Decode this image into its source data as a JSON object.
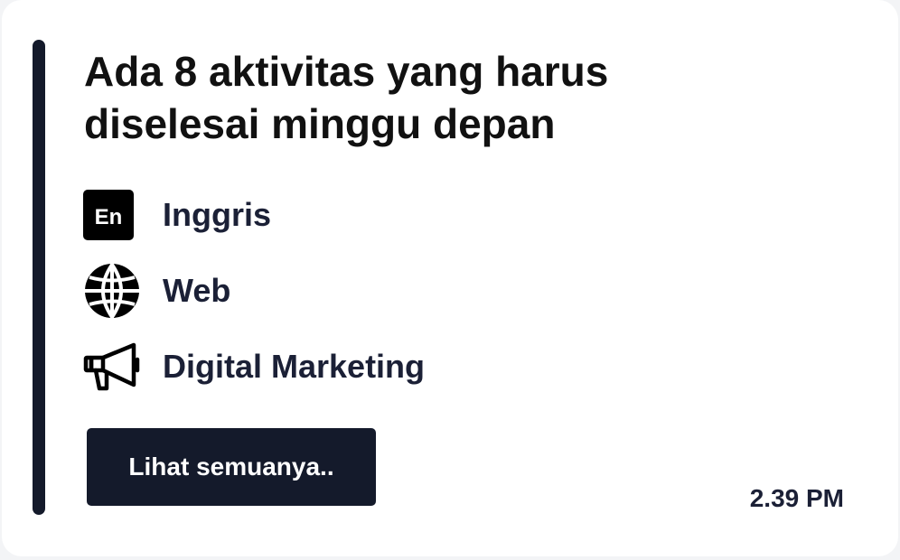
{
  "card": {
    "title": "Ada 8 aktivitas yang harus diselesai minggu depan",
    "items": [
      {
        "icon": "english-icon",
        "badge_text": "En",
        "label": "Inggris"
      },
      {
        "icon": "globe-icon",
        "label": "Web"
      },
      {
        "icon": "megaphone-icon",
        "label": "Digital Marketing"
      }
    ],
    "button_label": "Lihat semuanya..",
    "time": "2.39 PM"
  },
  "colors": {
    "accent": "#141a2b",
    "button": "#141a2b",
    "text": "#1b2036"
  }
}
